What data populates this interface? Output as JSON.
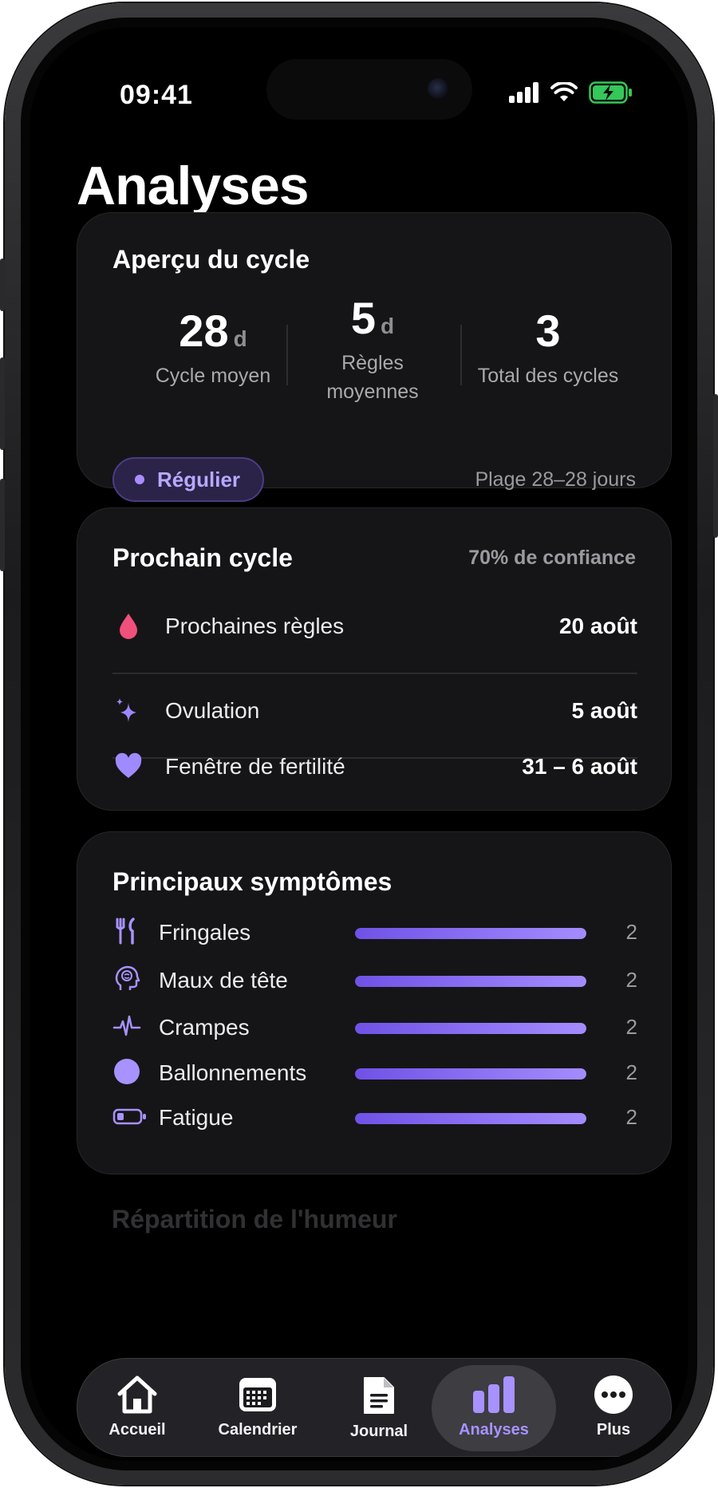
{
  "status_bar": {
    "time": "09:41"
  },
  "page": {
    "title": "Analyses"
  },
  "overview": {
    "title": "Aperçu du cycle",
    "stats": [
      {
        "value": "28",
        "unit": "d",
        "label": "Cycle moyen"
      },
      {
        "value": "5",
        "unit": "d",
        "label": "Règles moyennes"
      },
      {
        "value": "3",
        "unit": "",
        "label": "Total des cycles"
      }
    ],
    "badge": "Régulier",
    "range": "Plage 28–28 jours"
  },
  "next_cycle": {
    "title": "Prochain cycle",
    "confidence": "70% de confiance",
    "rows": [
      {
        "icon": "drop-icon",
        "label": "Prochaines règles",
        "value": "20 août"
      },
      {
        "icon": "sparkle-icon",
        "label": "Ovulation",
        "value": "5 août"
      },
      {
        "icon": "heart-icon",
        "label": "Fenêtre de fertilité",
        "value": "31 – 6 août"
      }
    ]
  },
  "symptoms": {
    "title": "Principaux symptômes",
    "items": [
      {
        "icon": "utensils-icon",
        "label": "Fringales",
        "count": "2",
        "fill_fraction": 1.0
      },
      {
        "icon": "brain-head-icon",
        "label": "Maux de tête",
        "count": "2",
        "fill_fraction": 1.0
      },
      {
        "icon": "pulse-icon",
        "label": "Crampes",
        "count": "2",
        "fill_fraction": 1.0
      },
      {
        "icon": "circle-icon",
        "label": "Ballonnements",
        "count": "2",
        "fill_fraction": 1.0
      },
      {
        "icon": "battery-low-icon",
        "label": "Fatigue",
        "count": "2",
        "fill_fraction": 1.0
      }
    ]
  },
  "next_section_title": "Répartition de l'humeur",
  "tabs": [
    {
      "icon": "house-icon",
      "label": "Accueil",
      "active": false
    },
    {
      "icon": "calendar-icon",
      "label": "Calendrier",
      "active": false
    },
    {
      "icon": "document-icon",
      "label": "Journal",
      "active": false
    },
    {
      "icon": "bar-chart-icon",
      "label": "Analyses",
      "active": true
    },
    {
      "icon": "more-icon",
      "label": "Plus",
      "active": false
    }
  ],
  "colors": {
    "accent": "#a892ff",
    "bar_start": "#6f52e6",
    "bar_end": "#a48cff",
    "drop": "#f0507c",
    "battery": "#34c759"
  }
}
